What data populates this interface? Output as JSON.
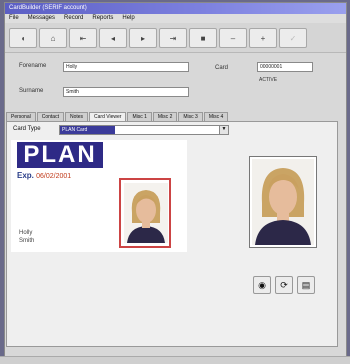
{
  "window": {
    "title": "CardBuilder (SERIF account)"
  },
  "menu": [
    "File",
    "Messages",
    "Record",
    "Reports",
    "Help"
  ],
  "toolbar": [
    {
      "glyph": "◖",
      "dim": false
    },
    {
      "glyph": "⌂",
      "dim": false
    },
    {
      "glyph": "⇤",
      "dim": false
    },
    {
      "glyph": "◂",
      "dim": false
    },
    {
      "glyph": "▸",
      "dim": false
    },
    {
      "glyph": "⇥",
      "dim": false
    },
    {
      "glyph": "■",
      "dim": false
    },
    {
      "glyph": "‒",
      "dim": false
    },
    {
      "glyph": "+",
      "dim": false
    },
    {
      "glyph": "✓",
      "dim": true
    }
  ],
  "form": {
    "forename_label": "Forename",
    "forename_value": "Holly",
    "surname_label": "Surname",
    "surname_value": "Smith",
    "card_label": "Card",
    "card_value": "00000001",
    "status": "ACTIVE"
  },
  "tabs": [
    "Personal",
    "Contact",
    "Notes",
    "Card Viewer",
    "Misc 1",
    "Misc 2",
    "Misc 3",
    "Misc 4"
  ],
  "active_tab": 3,
  "panel": {
    "card_type_label": "Card Type",
    "card_type_value": "PLAN Card"
  },
  "card": {
    "logo": "PLAN",
    "exp_label": "Exp.",
    "exp_value": "06/02/2001",
    "first": "Holly",
    "last": "Smith"
  },
  "photo_buttons": [
    {
      "icon": "camera-icon",
      "glyph": "◉"
    },
    {
      "icon": "rotate-icon",
      "glyph": "⟳"
    },
    {
      "icon": "card-print-icon",
      "glyph": "▤"
    }
  ],
  "colors": {
    "accent": "#3b3b9a",
    "title_gradient": "#5b5ec4",
    "exp_value": "#c03a1a"
  }
}
